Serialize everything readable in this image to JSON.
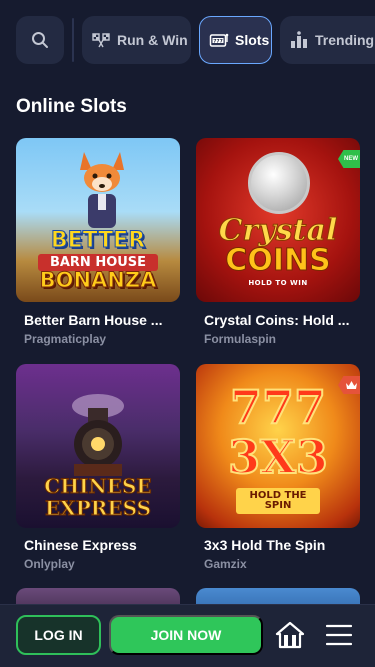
{
  "categories": [
    {
      "label": "Run & Win",
      "icon": "checkered-flags-icon",
      "active": false
    },
    {
      "label": "Slots",
      "icon": "slot-machine-icon",
      "active": true
    },
    {
      "label": "Trending",
      "icon": "trending-chart-icon",
      "active": false
    }
  ],
  "search": {
    "icon": "search-icon"
  },
  "section": {
    "title": "Online Slots"
  },
  "games": [
    {
      "title": "Better Barn House ...",
      "provider": "Pragmaticplay",
      "art": [
        "BETTER",
        "BARN HOUSE",
        "BONANZA"
      ],
      "badge": ""
    },
    {
      "title": "Crystal Coins: Hold ...",
      "provider": "Formulaspin",
      "art": [
        "Crystal",
        "COINS",
        "HOLD TO WIN"
      ],
      "badge": "NEW"
    },
    {
      "title": "Chinese Express",
      "provider": "Onlyplay",
      "art": [
        "CHINESE",
        "EXPRESS"
      ],
      "badge": ""
    },
    {
      "title": "3x3 Hold The Spin",
      "provider": "Gamzix",
      "art": [
        "777",
        "3X3",
        "HOLD THE SPIN"
      ],
      "badge": "crown"
    }
  ],
  "bottom_bar": {
    "login_label": "LOG IN",
    "join_label": "JOIN NOW",
    "home_icon": "home-icon",
    "menu_icon": "hamburger-menu-icon"
  },
  "colors": {
    "background": "#161b2f",
    "accent_green": "#2fc65a",
    "active_border": "#6aa8ff",
    "new_badge": "#2fbf4a",
    "crown_badge": "#e5533a"
  }
}
